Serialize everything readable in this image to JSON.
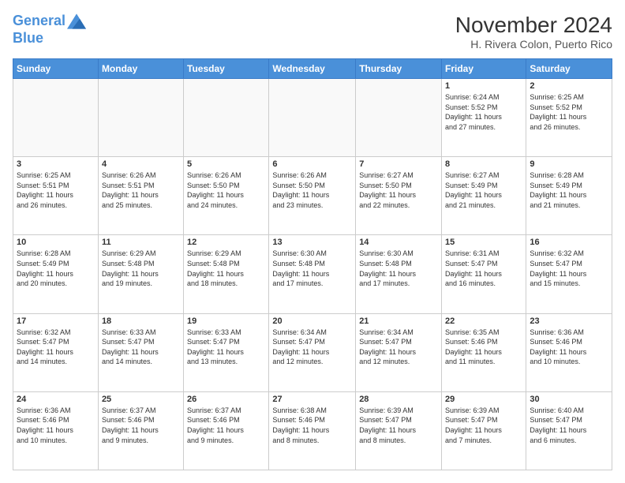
{
  "header": {
    "logo_line1": "General",
    "logo_line2": "Blue",
    "month_year": "November 2024",
    "location": "H. Rivera Colon, Puerto Rico"
  },
  "weekdays": [
    "Sunday",
    "Monday",
    "Tuesday",
    "Wednesday",
    "Thursday",
    "Friday",
    "Saturday"
  ],
  "weeks": [
    [
      {
        "day": "",
        "info": ""
      },
      {
        "day": "",
        "info": ""
      },
      {
        "day": "",
        "info": ""
      },
      {
        "day": "",
        "info": ""
      },
      {
        "day": "",
        "info": ""
      },
      {
        "day": "1",
        "info": "Sunrise: 6:24 AM\nSunset: 5:52 PM\nDaylight: 11 hours\nand 27 minutes."
      },
      {
        "day": "2",
        "info": "Sunrise: 6:25 AM\nSunset: 5:52 PM\nDaylight: 11 hours\nand 26 minutes."
      }
    ],
    [
      {
        "day": "3",
        "info": "Sunrise: 6:25 AM\nSunset: 5:51 PM\nDaylight: 11 hours\nand 26 minutes."
      },
      {
        "day": "4",
        "info": "Sunrise: 6:26 AM\nSunset: 5:51 PM\nDaylight: 11 hours\nand 25 minutes."
      },
      {
        "day": "5",
        "info": "Sunrise: 6:26 AM\nSunset: 5:50 PM\nDaylight: 11 hours\nand 24 minutes."
      },
      {
        "day": "6",
        "info": "Sunrise: 6:26 AM\nSunset: 5:50 PM\nDaylight: 11 hours\nand 23 minutes."
      },
      {
        "day": "7",
        "info": "Sunrise: 6:27 AM\nSunset: 5:50 PM\nDaylight: 11 hours\nand 22 minutes."
      },
      {
        "day": "8",
        "info": "Sunrise: 6:27 AM\nSunset: 5:49 PM\nDaylight: 11 hours\nand 21 minutes."
      },
      {
        "day": "9",
        "info": "Sunrise: 6:28 AM\nSunset: 5:49 PM\nDaylight: 11 hours\nand 21 minutes."
      }
    ],
    [
      {
        "day": "10",
        "info": "Sunrise: 6:28 AM\nSunset: 5:49 PM\nDaylight: 11 hours\nand 20 minutes."
      },
      {
        "day": "11",
        "info": "Sunrise: 6:29 AM\nSunset: 5:48 PM\nDaylight: 11 hours\nand 19 minutes."
      },
      {
        "day": "12",
        "info": "Sunrise: 6:29 AM\nSunset: 5:48 PM\nDaylight: 11 hours\nand 18 minutes."
      },
      {
        "day": "13",
        "info": "Sunrise: 6:30 AM\nSunset: 5:48 PM\nDaylight: 11 hours\nand 17 minutes."
      },
      {
        "day": "14",
        "info": "Sunrise: 6:30 AM\nSunset: 5:48 PM\nDaylight: 11 hours\nand 17 minutes."
      },
      {
        "day": "15",
        "info": "Sunrise: 6:31 AM\nSunset: 5:47 PM\nDaylight: 11 hours\nand 16 minutes."
      },
      {
        "day": "16",
        "info": "Sunrise: 6:32 AM\nSunset: 5:47 PM\nDaylight: 11 hours\nand 15 minutes."
      }
    ],
    [
      {
        "day": "17",
        "info": "Sunrise: 6:32 AM\nSunset: 5:47 PM\nDaylight: 11 hours\nand 14 minutes."
      },
      {
        "day": "18",
        "info": "Sunrise: 6:33 AM\nSunset: 5:47 PM\nDaylight: 11 hours\nand 14 minutes."
      },
      {
        "day": "19",
        "info": "Sunrise: 6:33 AM\nSunset: 5:47 PM\nDaylight: 11 hours\nand 13 minutes."
      },
      {
        "day": "20",
        "info": "Sunrise: 6:34 AM\nSunset: 5:47 PM\nDaylight: 11 hours\nand 12 minutes."
      },
      {
        "day": "21",
        "info": "Sunrise: 6:34 AM\nSunset: 5:47 PM\nDaylight: 11 hours\nand 12 minutes."
      },
      {
        "day": "22",
        "info": "Sunrise: 6:35 AM\nSunset: 5:46 PM\nDaylight: 11 hours\nand 11 minutes."
      },
      {
        "day": "23",
        "info": "Sunrise: 6:36 AM\nSunset: 5:46 PM\nDaylight: 11 hours\nand 10 minutes."
      }
    ],
    [
      {
        "day": "24",
        "info": "Sunrise: 6:36 AM\nSunset: 5:46 PM\nDaylight: 11 hours\nand 10 minutes."
      },
      {
        "day": "25",
        "info": "Sunrise: 6:37 AM\nSunset: 5:46 PM\nDaylight: 11 hours\nand 9 minutes."
      },
      {
        "day": "26",
        "info": "Sunrise: 6:37 AM\nSunset: 5:46 PM\nDaylight: 11 hours\nand 9 minutes."
      },
      {
        "day": "27",
        "info": "Sunrise: 6:38 AM\nSunset: 5:46 PM\nDaylight: 11 hours\nand 8 minutes."
      },
      {
        "day": "28",
        "info": "Sunrise: 6:39 AM\nSunset: 5:47 PM\nDaylight: 11 hours\nand 8 minutes."
      },
      {
        "day": "29",
        "info": "Sunrise: 6:39 AM\nSunset: 5:47 PM\nDaylight: 11 hours\nand 7 minutes."
      },
      {
        "day": "30",
        "info": "Sunrise: 6:40 AM\nSunset: 5:47 PM\nDaylight: 11 hours\nand 6 minutes."
      }
    ]
  ]
}
